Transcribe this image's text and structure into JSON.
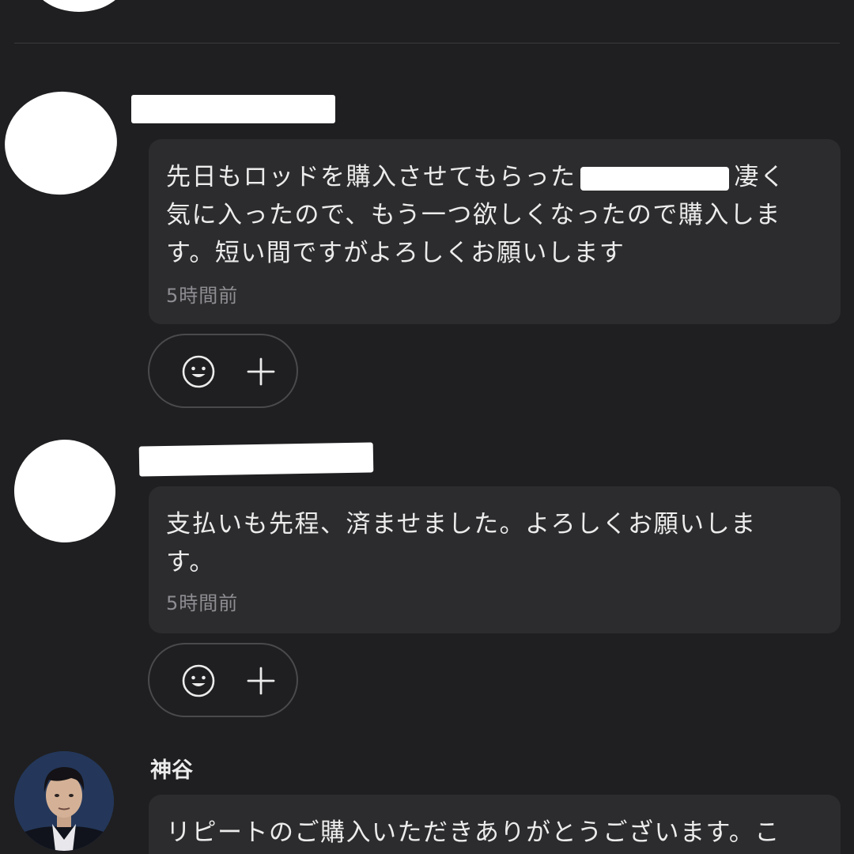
{
  "messages": [
    {
      "text_part1": "先日もロッドを購入させてもらった",
      "text_part2": "凄く\n気に入ったので、もう一つ欲しくなったので購入しま\nす。短い間ですがよろしくお願いします",
      "timestamp": "5時間前"
    },
    {
      "text": "支払いも先程、済ませました。よろしくお願いしま\nす。",
      "timestamp": "5時間前"
    }
  ],
  "seller": {
    "name": "神谷",
    "message_text": "リピートのご購入いただきありがとうございます。こ"
  },
  "reaction_bar": {
    "emoji_icon": "smiley-icon",
    "add_icon": "plus-icon"
  },
  "colors": {
    "background": "#1f1f21",
    "bubble": "#2c2c2e",
    "text": "#ececec",
    "timestamp": "#8e8e93"
  }
}
